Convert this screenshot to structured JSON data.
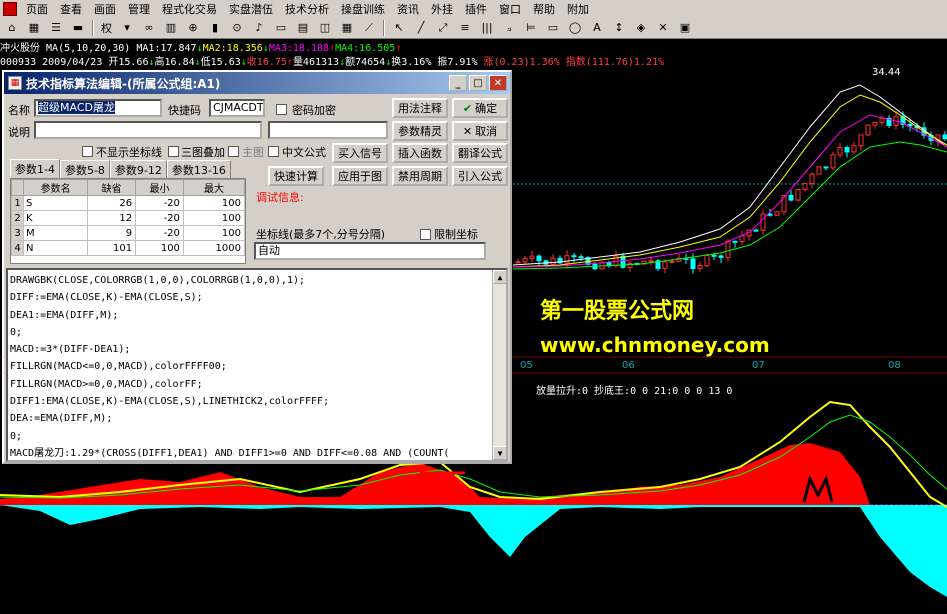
{
  "menubar": {
    "items": [
      "页面",
      "查看",
      "画面",
      "管理",
      "程式化交易",
      "实盘潜伍",
      "技术分析",
      "操盘训练",
      "资讯",
      "外挂",
      "插件",
      "窗口",
      "帮助",
      "附加"
    ]
  },
  "toolbar": {
    "right_label": "权"
  },
  "info": {
    "line1": [
      {
        "text": "冲火股份 ",
        "color": "#ffffff"
      },
      {
        "text": "MA(5,10,20,30) ",
        "color": "#ffffff"
      },
      {
        "text": "MA1:17.847",
        "color": "#ffffff"
      },
      {
        "text": "↓",
        "color": "#00ff00"
      },
      {
        "text": "MA2:18.356",
        "color": "#ffff00"
      },
      {
        "text": "↓",
        "color": "#00ff00"
      },
      {
        "text": "MA3:18.108",
        "color": "#ff00ff"
      },
      {
        "text": "↑",
        "color": "#ff0000"
      },
      {
        "text": "MA4:16.505",
        "color": "#00ff00"
      },
      {
        "text": "↑",
        "color": "#ff0000"
      }
    ],
    "line2": [
      {
        "text": "000933 2009/04/23 ",
        "color": "#ffffff"
      },
      {
        "text": "开15.66",
        "color": "#ffffff"
      },
      {
        "text": "↓",
        "color": "#00ff00"
      },
      {
        "text": "高16.84",
        "color": "#ffffff"
      },
      {
        "text": "↓",
        "color": "#00ff00"
      },
      {
        "text": "低15.63",
        "color": "#ffffff"
      },
      {
        "text": "↓",
        "color": "#00ff00"
      },
      {
        "text": "收16.75",
        "color": "#ff4040"
      },
      {
        "text": "↑",
        "color": "#ff0000"
      },
      {
        "text": "量461313",
        "color": "#ffffff"
      },
      {
        "text": "↓",
        "color": "#00ff00"
      },
      {
        "text": "额74654",
        "color": "#ffffff"
      },
      {
        "text": "↓",
        "color": "#00ff00"
      },
      {
        "text": "换3.16%",
        "color": "#ffffff"
      },
      {
        "text": " 振7.91%",
        "color": "#ffffff"
      },
      {
        "text": " 涨(0.23)1.36%",
        "color": "#ff4040"
      },
      {
        "text": " 指数(111.76)1.21%",
        "color": "#ff4040"
      }
    ]
  },
  "chart": {
    "peak_label": "34.44",
    "months": [
      "05",
      "06",
      "07",
      "08"
    ],
    "indicator_label": "放量拉升:0  抄底王:0  0 21:0  0  0 13 0"
  },
  "watermark": {
    "line1": "第一股票公式网",
    "line2": "www.chnmoney.com"
  },
  "dialog": {
    "title": "技术指标算法编辑-(所属公式组:A1)",
    "name_label": "名称",
    "name_value": "超级MACD屠龙",
    "shortcut_label": "快捷码",
    "shortcut_value": "CJMACDT",
    "encrypt_label": "密码加密",
    "desc_label": "说明",
    "no_axis_label": "不显示坐标线",
    "overlay_label": "三图叠加",
    "main_label": "主图",
    "chinese_label": "中文公式",
    "tabs": [
      "参数1-4",
      "参数5-8",
      "参数9-12",
      "参数13-16"
    ],
    "param_headers": [
      "参数名",
      "缺省",
      "最小",
      "最大"
    ],
    "params": [
      {
        "n": "1",
        "name": "S",
        "def": "26",
        "min": "-20",
        "max": "100"
      },
      {
        "n": "2",
        "name": "K",
        "def": "12",
        "min": "-20",
        "max": "100"
      },
      {
        "n": "3",
        "name": "M",
        "def": "9",
        "min": "-20",
        "max": "100"
      },
      {
        "n": "4",
        "name": "N",
        "def": "101",
        "min": "100",
        "max": "1000"
      }
    ],
    "buttons": {
      "usage": "用法注释",
      "ok": "确定",
      "param_tune": "参数精灵",
      "cancel": "取消",
      "buy_signal": "买入信号",
      "insert_func": "插入函数",
      "translate": "翻译公式",
      "quick_calc": "快速计算",
      "apply": "应用于图",
      "ban_period": "禁用周期",
      "import": "引入公式"
    },
    "debug_label": "调试信息:",
    "axis_label": "坐标线(最多7个,分号分隔)",
    "limit_axis_label": "限制坐标",
    "axis_value": "自动",
    "code_lines": [
      "DRAWGBK(CLOSE,COLORRGB(1,0,0),COLORRGB(1,0,0),1);",
      "DIFF:=EMA(CLOSE,K)-EMA(CLOSE,S);",
      "DEA1:=EMA(DIFF,M);",
      "0;",
      "MACD:=3*(DIFF-DEA1);",
      "FILLRGN(MACD<=0,0,MACD),colorFFFF00;",
      "FILLRGN(MACD>=0,0,MACD),colorFF;",
      "DIFF1:EMA(CLOSE,K)-EMA(CLOSE,S),LINETHICK2,colorFFFF;",
      "DEA:=EMA(DIFF,M);",
      "0;",
      "MACD屠龙刀:1.29*(CROSS(DIFF1,DEA1) AND DIFF1>=0 AND DIFF<=0.08 AND (COUNT("
    ]
  }
}
